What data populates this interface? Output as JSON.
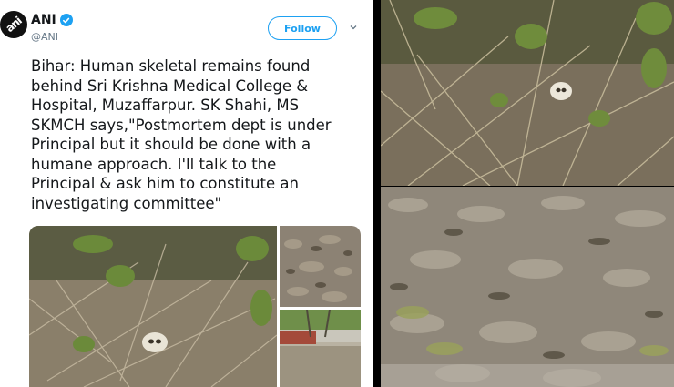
{
  "tweet": {
    "display_name": "ANI",
    "handle": "@ANI",
    "follow_label": "Follow",
    "text": "Bihar: Human skeletal remains found\nbehind Sri Krishna Medical College &\nHospital, Muzaffarpur. SK Shahi, MS\nSKMCH says,\"Postmortem dept is under\nPrincipal but it should be done with a\nhumane approach. I'll talk to the\nPrincipal & ask him to constitute an\ninvestigating committee\""
  },
  "colors": {
    "twitter_blue": "#1da1f2",
    "text_primary": "#14171a",
    "text_secondary": "#657786"
  },
  "icons": {
    "avatar": "ani-logo-icon",
    "verified": "verified-badge-icon",
    "menu": "chevron-down-icon"
  }
}
